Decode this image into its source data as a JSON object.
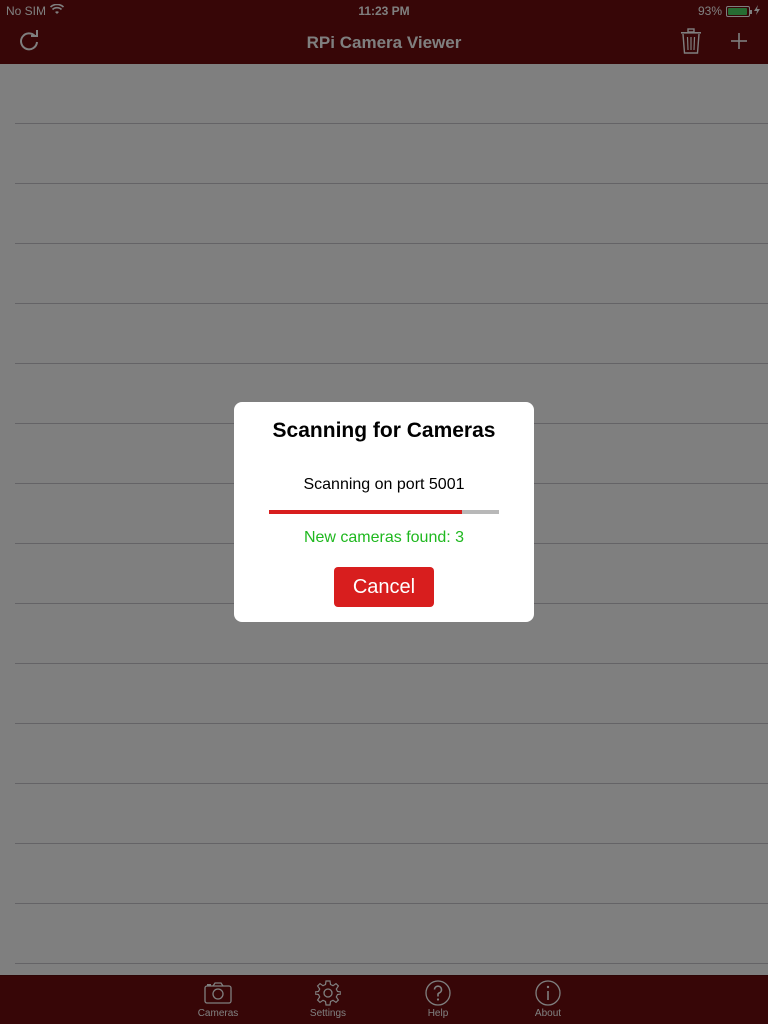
{
  "status_bar": {
    "carrier": "No SIM",
    "time": "11:23 PM",
    "battery_percent": "93%",
    "battery_level": 0.93,
    "icons": [
      "wifi-icon",
      "battery-icon",
      "charging-bolt-icon"
    ]
  },
  "nav_bar": {
    "title": "RPi Camera Viewer",
    "left_button": "refresh-icon",
    "right_buttons": [
      "trash-icon",
      "plus-icon"
    ]
  },
  "tab_bar": {
    "tabs": [
      {
        "label": "Cameras",
        "icon": "camera-icon"
      },
      {
        "label": "Settings",
        "icon": "gear-icon"
      },
      {
        "label": "Help",
        "icon": "question-mark-icon"
      },
      {
        "label": "About",
        "icon": "info-icon"
      }
    ]
  },
  "dialog": {
    "title": "Scanning for Cameras",
    "status": "Scanning on port 5001",
    "progress": 0.84,
    "found_text": "New cameras found: 3",
    "cancel_label": "Cancel"
  },
  "colors": {
    "bar": "#6e0d0e",
    "accent_red": "#d81e1e",
    "success_green": "#1fb81f"
  }
}
